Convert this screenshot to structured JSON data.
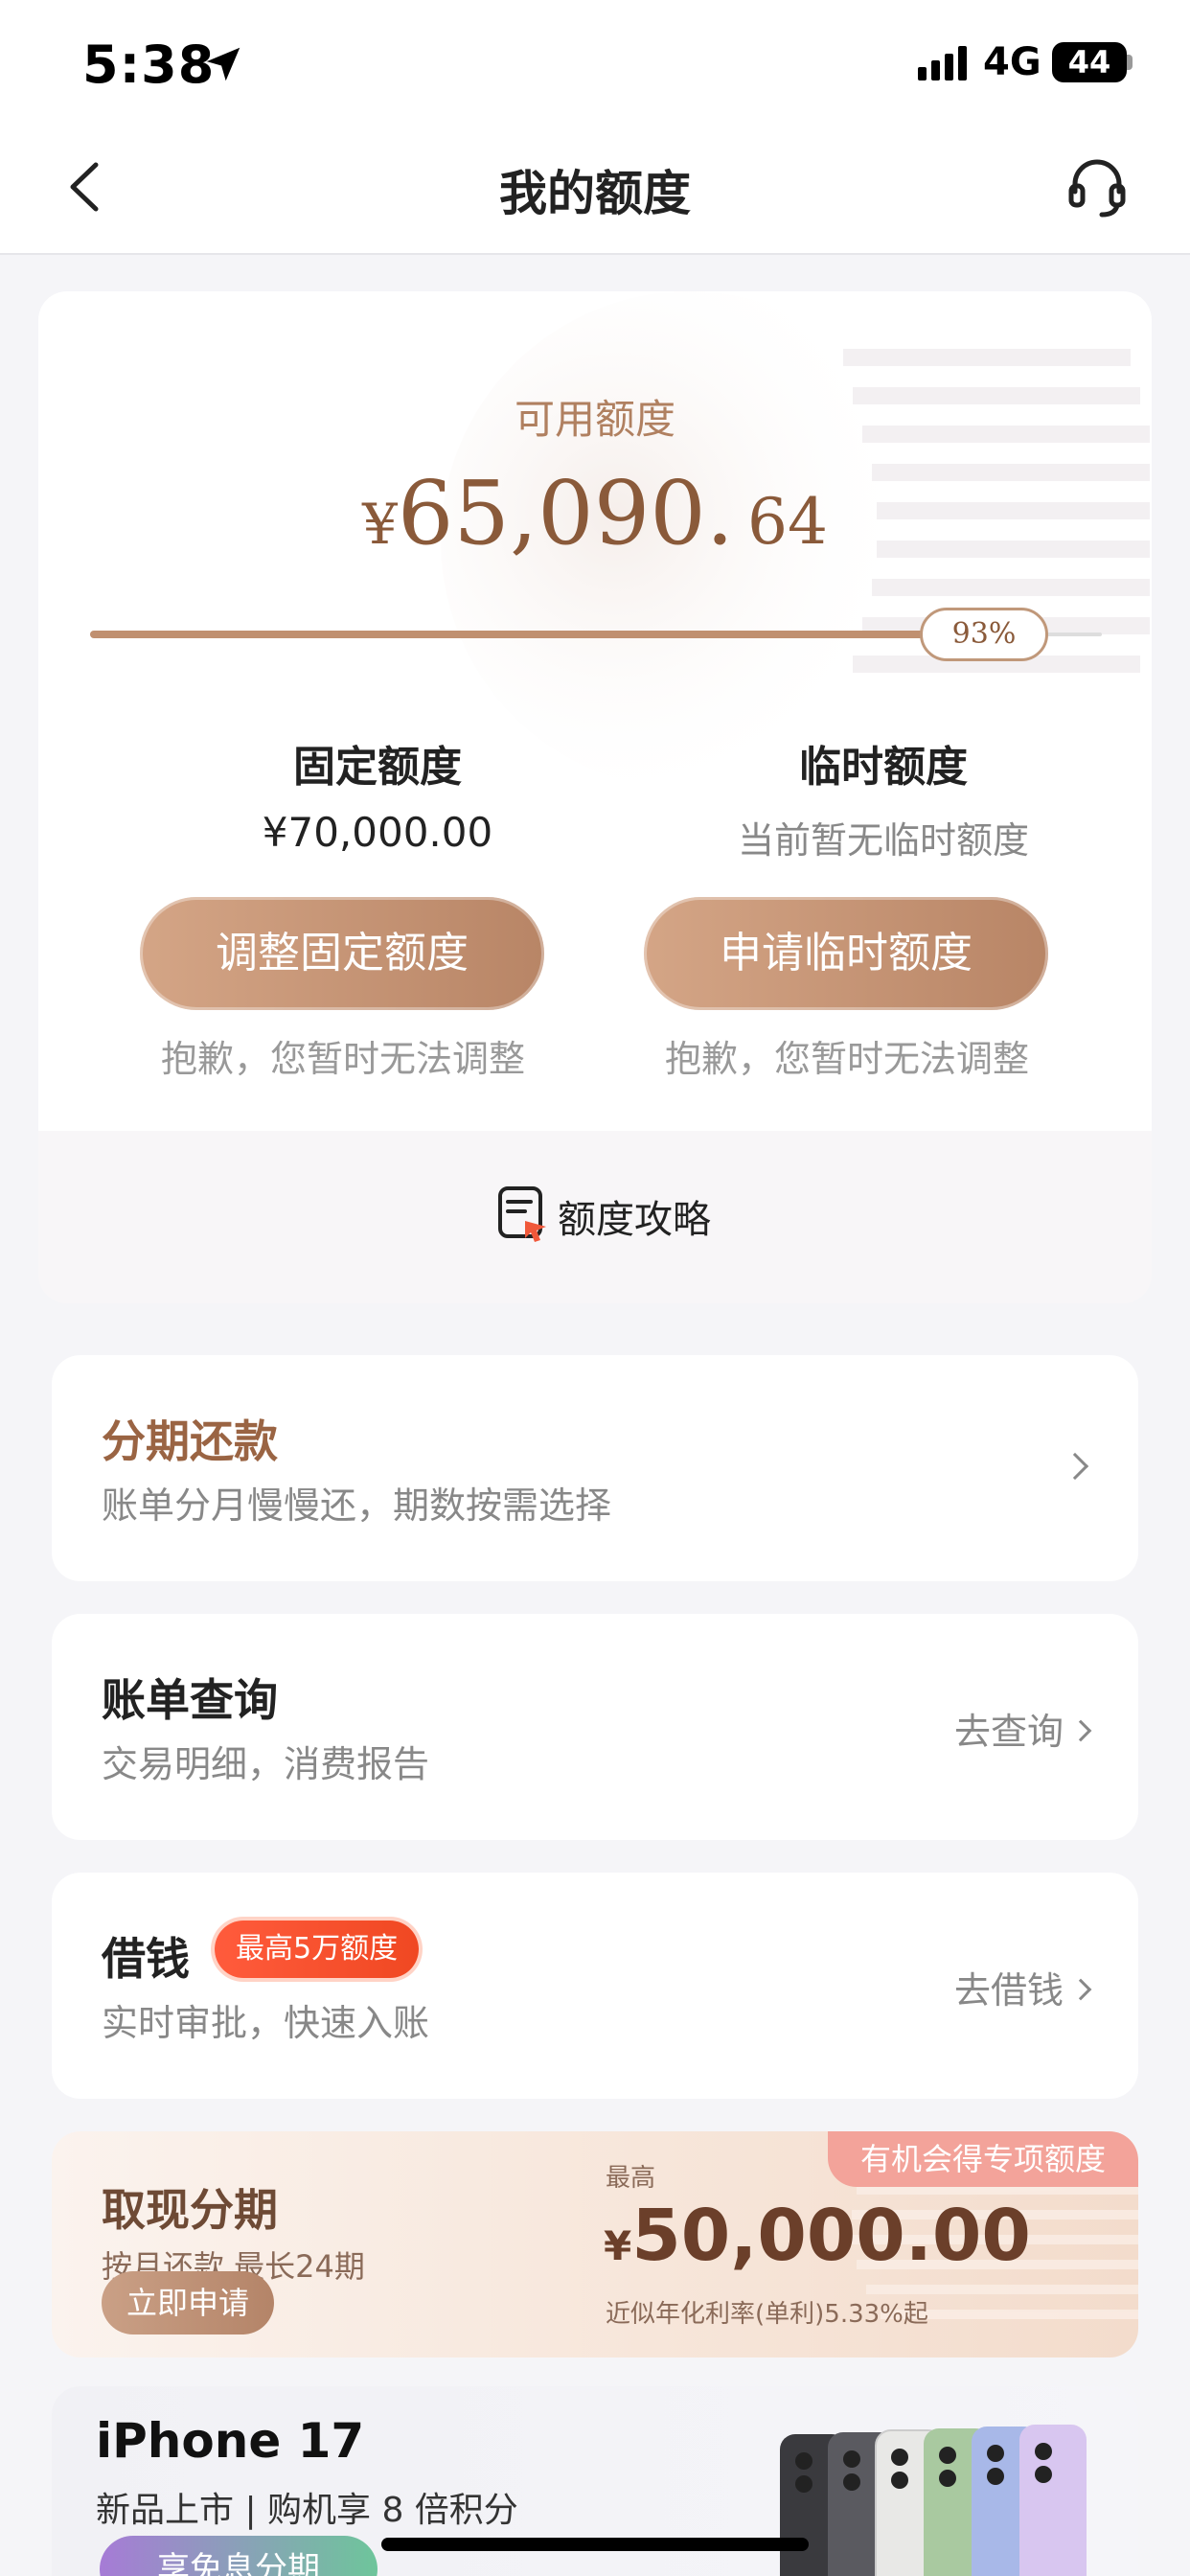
{
  "status_bar": {
    "time": "5:38",
    "network": "4G",
    "battery": "44",
    "icons": [
      "location-arrow-icon",
      "signal-icon",
      "battery-icon"
    ]
  },
  "nav": {
    "title": "我的额度",
    "back_icon": "chevron-left-icon",
    "service_icon": "headset-icon"
  },
  "limit_card": {
    "available_label": "可用额度",
    "currency": "¥",
    "amount_integer": "65,090.",
    "amount_decimal": "64",
    "usage_percent_label": "93%",
    "usage_fraction": 0.93,
    "fixed": {
      "title": "固定额度",
      "value": "¥70,000.00",
      "button": "调整固定额度",
      "note": "抱歉，您暂时无法调整"
    },
    "temporary": {
      "title": "临时额度",
      "value": "当前暂无临时额度",
      "button": "申请临时额度",
      "note": "抱歉，您暂时无法调整"
    },
    "strategy_label": "额度攻略"
  },
  "menu": {
    "installment": {
      "title": "分期还款",
      "subtitle": "账单分月慢慢还，期数按需选择"
    },
    "bill": {
      "title": "账单查询",
      "subtitle": "交易明细，消费报告",
      "action": "去查询"
    },
    "borrow": {
      "title": "借钱",
      "badge": "最高5万额度",
      "subtitle": "实时审批，快速入账",
      "action": "去借钱"
    }
  },
  "cash_banner": {
    "tag": "有机会得专项额度",
    "title": "取现分期",
    "subtitle": "按月还款 最长24期",
    "button": "立即申请",
    "max_label": "最高",
    "currency": "¥",
    "amount": "50,000.00",
    "rate": "近似年化利率(单利)5.33%起"
  },
  "iphone_promo": {
    "title": "iPhone 17",
    "subtitle": "新品上市 | 购机享 8 倍积分",
    "button": "享免息分期"
  },
  "colors": {
    "accent": "#b88566",
    "accent_dark": "#8a5a3a",
    "badge_red": "#f04822",
    "background": "#f5f5f8"
  }
}
